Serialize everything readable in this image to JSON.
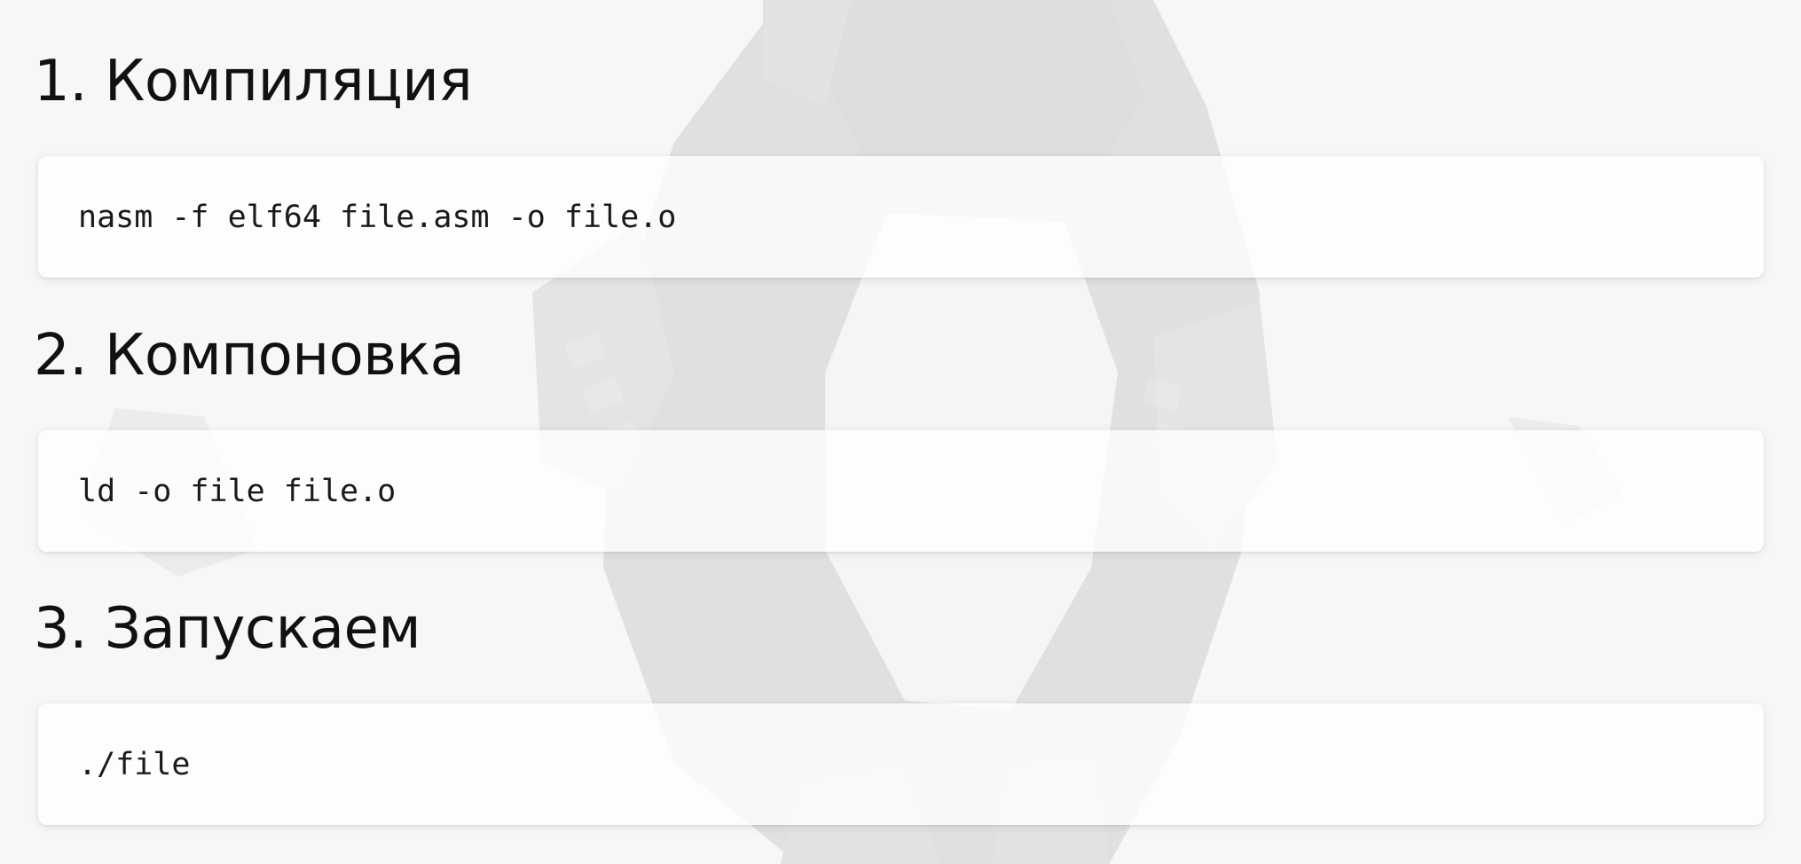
{
  "slide": {
    "steps": [
      {
        "heading": "1. Компиляция",
        "command": "nasm -f elf64 file.asm -o file.o"
      },
      {
        "heading": "2. Компоновка",
        "command": "ld -o file file.o"
      },
      {
        "heading": "3. Запускаем",
        "command": "./file"
      }
    ]
  },
  "background": {
    "illustration": "tux-penguin-lowpoly-faded",
    "color": "#f7f7f7"
  }
}
